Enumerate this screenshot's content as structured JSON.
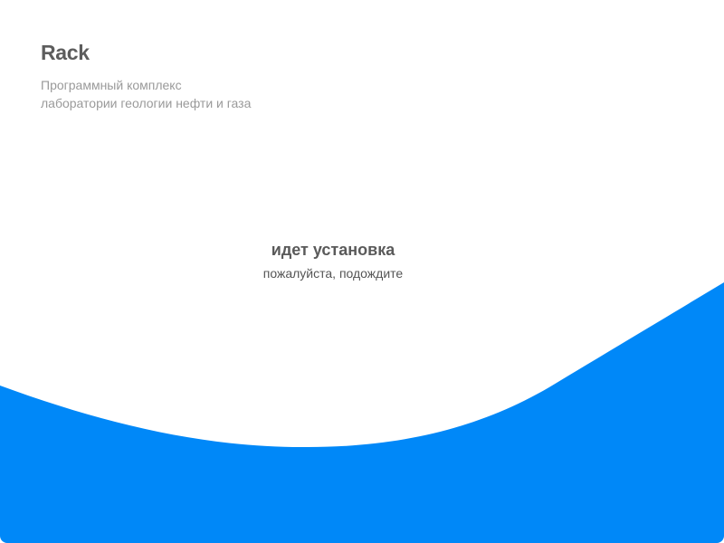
{
  "app": {
    "title": "Rack",
    "subtitle_line1": "Программный комплекс",
    "subtitle_line2": "лаборатории геологии нефти и газа"
  },
  "status": {
    "title": "идет установка",
    "subtitle": "пожалуйста, подождите"
  },
  "colors": {
    "accent": "#0088f8",
    "title_text": "#5d5d5d",
    "muted_text": "#9a9a9a"
  }
}
